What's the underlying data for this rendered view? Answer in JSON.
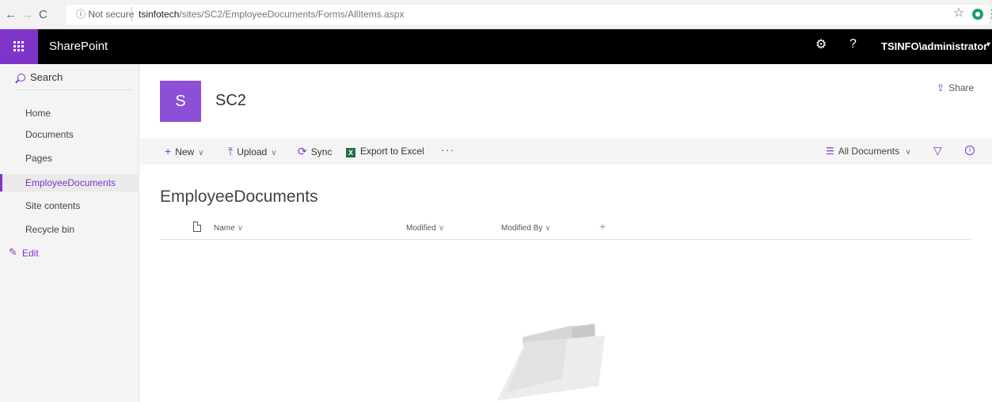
{
  "browser": {
    "not_secure_label": "Not secure",
    "url_host": "tsinfotech",
    "url_path": "/sites/SC2/EmployeeDocuments/Forms/AllItems.aspx"
  },
  "suite": {
    "app_name": "SharePoint",
    "user": "TSINFO\\administrator",
    "accent": "#7f34c9"
  },
  "left_nav": {
    "search_label": "Search",
    "items": [
      "Home",
      "Documents",
      "Pages",
      "EmployeeDocuments",
      "Site contents",
      "Recycle bin"
    ],
    "active_item": "EmployeeDocuments",
    "edit_label": "Edit"
  },
  "header": {
    "logo_letter": "S",
    "site_title": "SC2",
    "share_label": "Share"
  },
  "command_bar": {
    "new_label": "New",
    "upload_label": "Upload",
    "sync_label": "Sync",
    "export_label": "Export to Excel",
    "more_label": "···",
    "view_label": "All Documents"
  },
  "library": {
    "title": "EmployeeDocuments",
    "columns": [
      "Name",
      "Modified",
      "Modified By"
    ],
    "add_column_label": "+"
  }
}
